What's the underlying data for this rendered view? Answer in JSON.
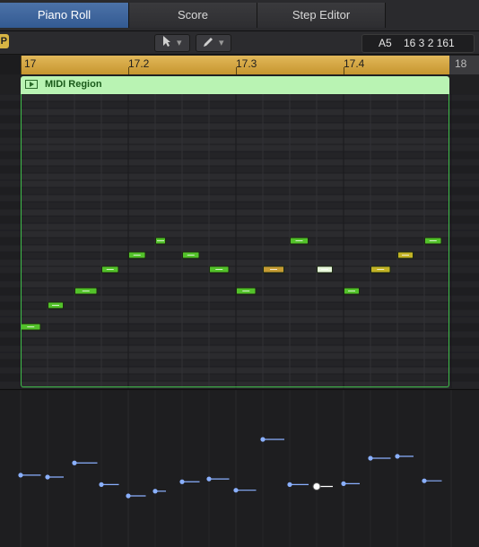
{
  "tabs": [
    {
      "label": "Piano Roll",
      "active": true
    },
    {
      "label": "Score",
      "active": false
    },
    {
      "label": "Step Editor",
      "active": false
    }
  ],
  "toolbar": {
    "catch_icon": "catch-icon",
    "pointer_tool_icon": "pointer-tool-icon",
    "pencil_tool_icon": "pencil-tool-icon",
    "dropdown_glyph": "▾",
    "position_note": "A5",
    "position_value": "16 3 2 161"
  },
  "ruler": {
    "labels": [
      "17",
      "17.2",
      "17.3",
      "17.4",
      "18"
    ]
  },
  "region": {
    "name": "MIDI Region",
    "color": "#b9f3b3",
    "border_color": "#3fbd4a"
  },
  "colors": {
    "note_green": "#53c22a",
    "note_olive": "#c3b326",
    "note_orange": "#c59b33",
    "note_selected": "#e7f7da",
    "velocity_line": "#8ab0ff"
  },
  "notes": [
    {
      "start": 0.0,
      "len": 0.75,
      "pitch": 0,
      "vel": 0.62,
      "color": "green"
    },
    {
      "start": 1.0,
      "len": 0.6,
      "pitch": 3,
      "vel": 0.6,
      "color": "green"
    },
    {
      "start": 2.0,
      "len": 0.85,
      "pitch": 5,
      "vel": 0.75,
      "color": "green"
    },
    {
      "start": 3.0,
      "len": 0.65,
      "pitch": 8,
      "vel": 0.52,
      "color": "green"
    },
    {
      "start": 4.0,
      "len": 0.65,
      "pitch": 10,
      "vel": 0.4,
      "color": "green"
    },
    {
      "start": 5.0,
      "len": 0.4,
      "pitch": 12,
      "vel": 0.45,
      "color": "green"
    },
    {
      "start": 6.0,
      "len": 0.65,
      "pitch": 10,
      "vel": 0.55,
      "color": "green"
    },
    {
      "start": 7.0,
      "len": 0.75,
      "pitch": 8,
      "vel": 0.58,
      "color": "green"
    },
    {
      "start": 8.0,
      "len": 0.75,
      "pitch": 5,
      "vel": 0.46,
      "color": "green"
    },
    {
      "start": 9.0,
      "len": 0.8,
      "pitch": 8,
      "vel": 1.0,
      "color": "orange"
    },
    {
      "start": 10.0,
      "len": 0.7,
      "pitch": 12,
      "vel": 0.52,
      "color": "green"
    },
    {
      "start": 11.0,
      "len": 0.6,
      "pitch": 8,
      "vel": 0.5,
      "color": "selected"
    },
    {
      "start": 12.0,
      "len": 0.6,
      "pitch": 5,
      "vel": 0.53,
      "color": "green"
    },
    {
      "start": 13.0,
      "len": 0.75,
      "pitch": 8,
      "vel": 0.8,
      "color": "olive"
    },
    {
      "start": 14.0,
      "len": 0.6,
      "pitch": 10,
      "vel": 0.82,
      "color": "olive"
    },
    {
      "start": 15.0,
      "len": 0.65,
      "pitch": 12,
      "vel": 0.56,
      "color": "green"
    }
  ]
}
